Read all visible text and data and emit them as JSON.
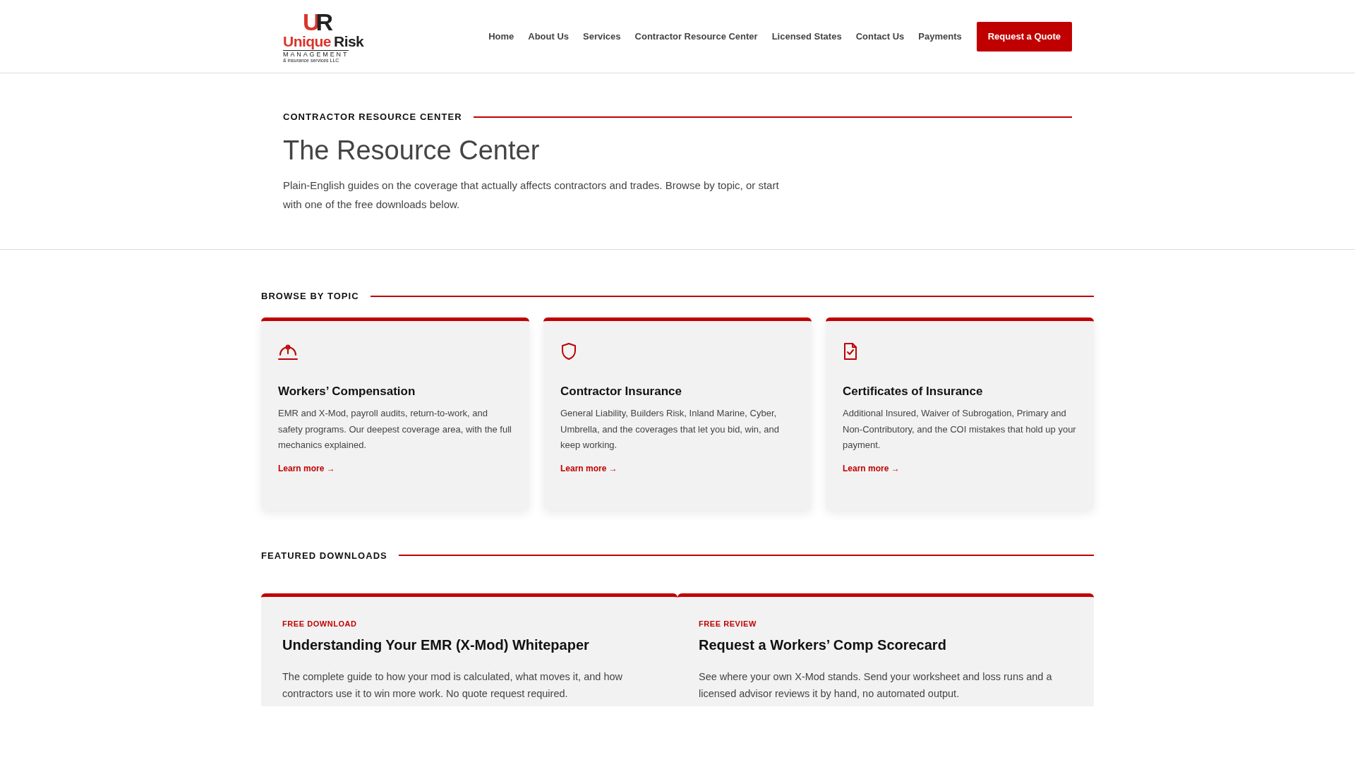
{
  "header": {
    "logo": {
      "monogram_left": "U",
      "monogram_right": "R",
      "name_left": "Unique",
      "name_right": "Risk",
      "line2": "MANAGEMENT",
      "line3": "& insurance services LLC"
    },
    "nav": [
      {
        "label": "Home"
      },
      {
        "label": "About Us"
      },
      {
        "label": "Services"
      },
      {
        "label": "Contractor Resource Center"
      },
      {
        "label": "Licensed States"
      },
      {
        "label": "Contact Us"
      },
      {
        "label": "Payments"
      }
    ],
    "cta": "Request a Quote"
  },
  "hero": {
    "eyebrow": "CONTRACTOR RESOURCE CENTER",
    "title": "The Resource Center",
    "intro": "Plain-English guides on the coverage that actually affects contractors and trades. Browse by topic, or start with one of the free downloads below."
  },
  "topics": {
    "heading": "BROWSE BY TOPIC",
    "cards": [
      {
        "kind": "hardhat",
        "title": "Workers’ Compensation",
        "text": "EMR and X-Mod, payroll audits, return-to-work, and safety programs. Our deepest coverage area, with the full mechanics explained.",
        "link": "Learn more",
        "arrow": "→"
      },
      {
        "kind": "shield",
        "title": "Contractor Insurance",
        "text": "General Liability, Builders Risk, Inland Marine, Cyber, Umbrella, and the coverages that let you bid, win, and keep working.",
        "link": "Learn more",
        "arrow": "→"
      },
      {
        "kind": "certificate",
        "title": "Certificates of Insurance",
        "text": "Additional Insured, Waiver of Subrogation, Primary and Non-Contributory, and the COI mistakes that hold up your payment.",
        "link": "Learn more",
        "arrow": "→"
      }
    ]
  },
  "downloads": {
    "heading": "FEATURED DOWNLOADS",
    "cards": [
      {
        "tag": "FREE DOWNLOAD",
        "title": "Understanding Your EMR (X-Mod) Whitepaper",
        "text": "The complete guide to how your mod is calculated, what moves it, and how contractors use it to win more work. No quote request required."
      },
      {
        "tag": "FREE REVIEW",
        "title": "Request a Workers’ Comp Scorecard",
        "text": "See where your own X-Mod stands. Send your worksheet and loss runs and a licensed advisor reviews it by hand, no automated output."
      }
    ]
  }
}
